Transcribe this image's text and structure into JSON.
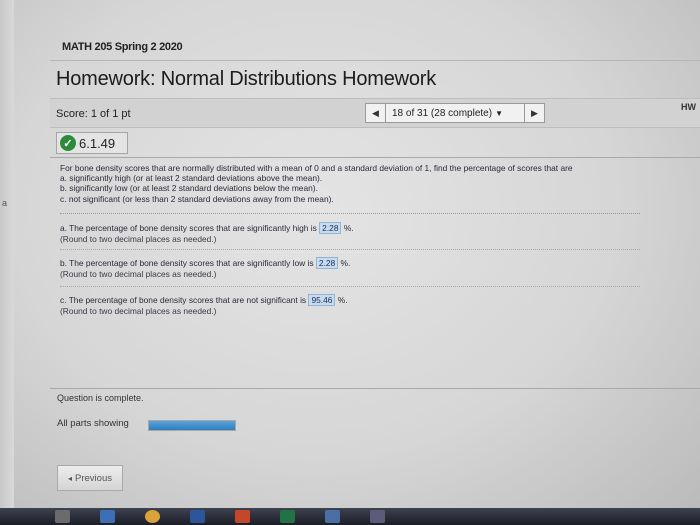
{
  "page": {
    "course": "MATH 205 Spring 2 2020",
    "title": "Homework: Normal Distributions Homework",
    "score": "Score: 1 of 1 pt",
    "nav": {
      "position": "18 of 31 (28 complete)",
      "prev_icon": "left-triangle-icon",
      "next_icon": "right-triangle-icon",
      "dropdown_icon": "down-triangle-icon"
    },
    "corner_label": "HW",
    "left_edge_mark": "a",
    "question_number": "6.1.49",
    "status_icon": "check-circle-icon",
    "status_color": "#2e8b3c"
  },
  "problem": {
    "intro": "For bone density scores that are normally distributed with a mean of 0 and a standard deviation of 1, find the percentage of scores that are",
    "a": "a. significantly high (or at least 2 standard deviations above the mean).",
    "b": "b. significantly low (or at least 2 standard deviations below the mean).",
    "c": "c. not significant (or less than 2 standard deviations away from the mean)."
  },
  "answers": [
    {
      "prefix": "a. The percentage of bone density scores that are significantly high is",
      "value": "2.28",
      "suffix": "%.",
      "hint": "(Round to two decimal places as needed.)"
    },
    {
      "prefix": "b. The percentage of bone density scores that are significantly low is",
      "value": "2.28",
      "suffix": "%.",
      "hint": "(Round to two decimal places as needed.)"
    },
    {
      "prefix": "c. The percentage of bone density scores that are not significant is",
      "value": "95.46",
      "suffix": "%.",
      "hint": "(Round to two decimal places as needed.)"
    }
  ],
  "footer": {
    "question_complete": "Question is complete.",
    "parts_showing": "All parts showing",
    "progress_fraction": 1.0,
    "progress_color": "#2f7ec0",
    "previous_label": "Previous",
    "previous_icon": "left-arrow-icon"
  },
  "taskbar": {
    "icons": [
      "start-icon",
      "browser-icon",
      "chrome-icon",
      "word-icon",
      "powerpoint-icon",
      "excel-icon",
      "store-icon",
      "app-icon"
    ]
  }
}
